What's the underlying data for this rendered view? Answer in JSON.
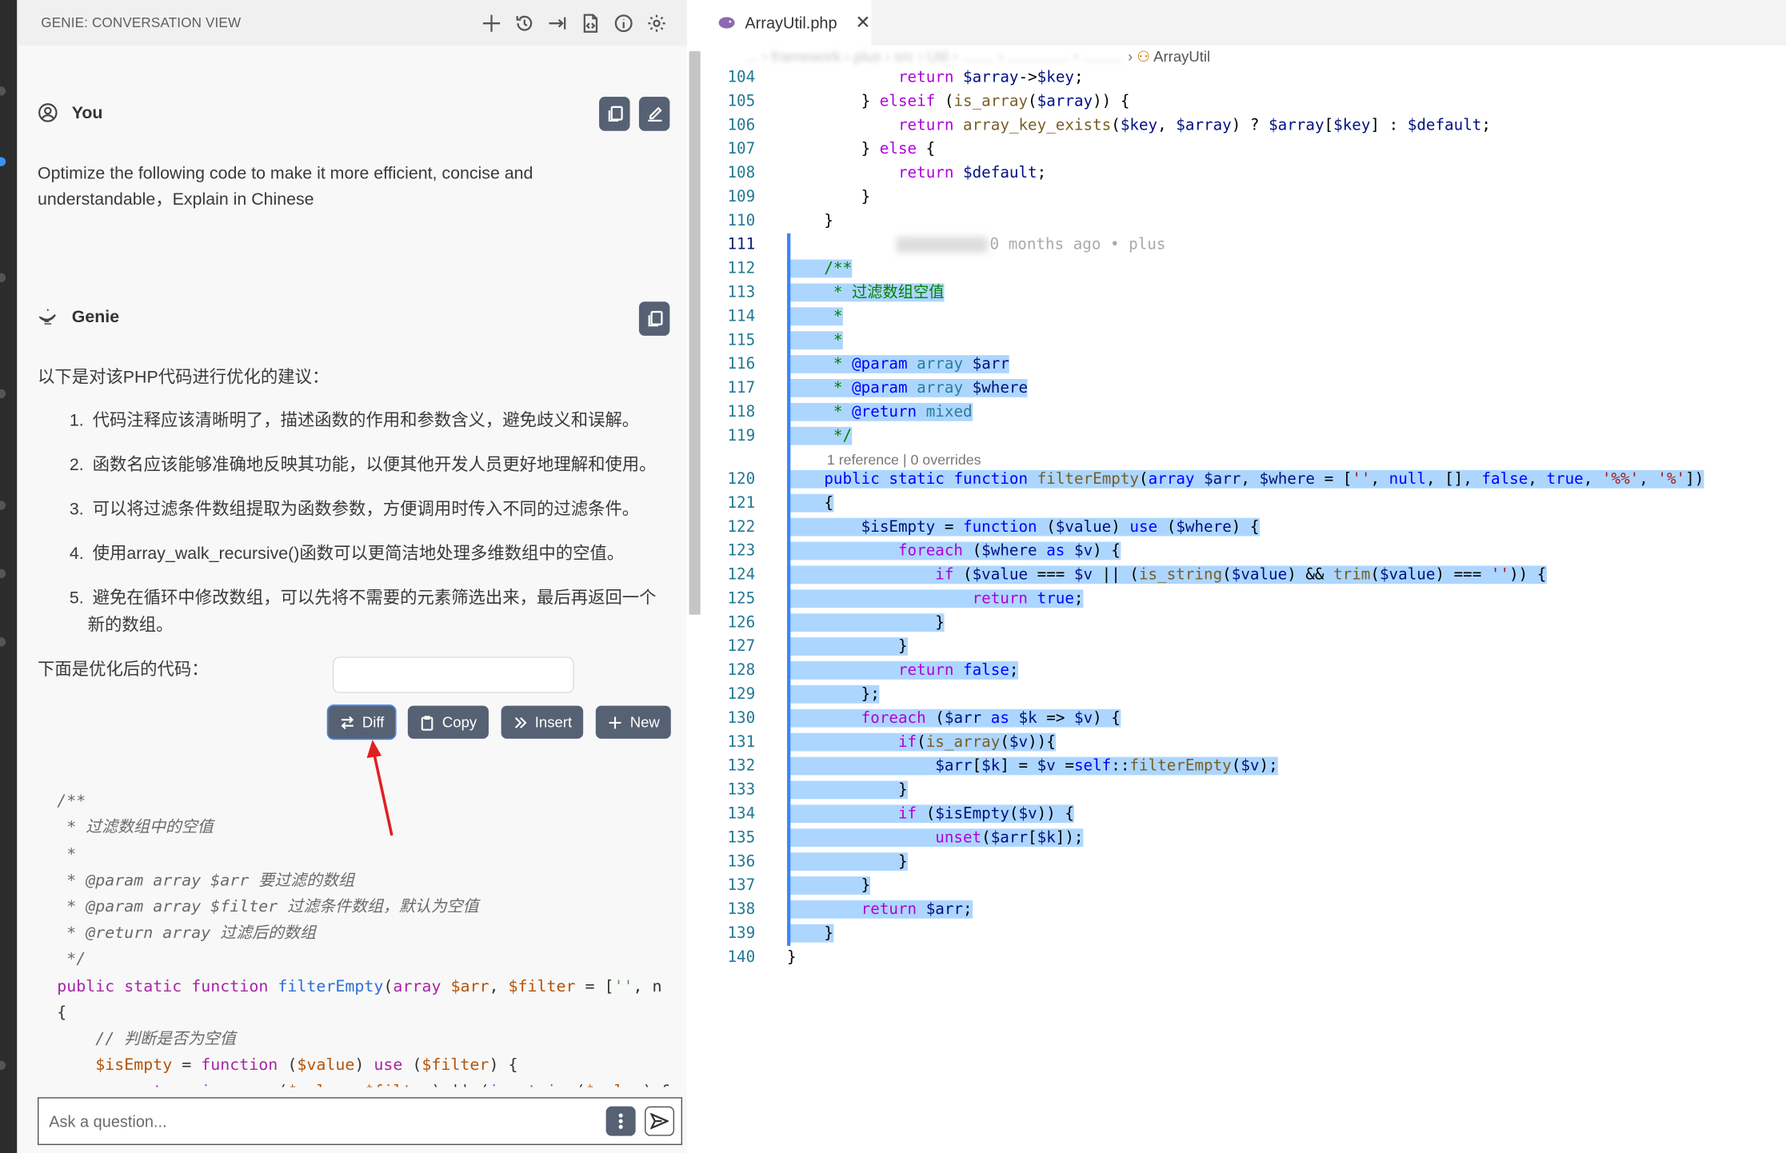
{
  "genie": {
    "title": "GENIE: CONVERSATION VIEW",
    "user": {
      "name": "You",
      "message": "Optimize the following code to make it more efficient, concise and understandable，Explain in Chinese"
    },
    "assistant": {
      "name": "Genie",
      "intro": "以下是对该PHP代码进行优化的建议：",
      "suggestions": [
        "代码注释应该清晰明了，描述函数的作用和参数含义，避免歧义和误解。",
        "函数名应该能够准确地反映其功能，以便其他开发人员更好地理解和使用。",
        "可以将过滤条件数组提取为函数参数，方便调用时传入不同的过滤条件。",
        "使用array_walk_recursive()函数可以更简洁地处理多维数组中的空值。",
        "避免在循环中修改数组，可以先将不需要的元素筛选出来，最后再返回一个新的数组。"
      ],
      "code_intro": "下面是优化后的代码："
    },
    "code_actions": {
      "diff": "Diff",
      "copy": "Copy",
      "insert": "Insert",
      "new": "New"
    },
    "code_lines": [
      "/**",
      " * 过滤数组中的空值",
      " *",
      " * @param array $arr 要过滤的数组",
      " * @param array $filter 过滤条件数组，默认为空值",
      " * @return array 过滤后的数组",
      " */",
      "public static function filterEmpty(array $arr, $filter = ['', n",
      "{",
      "    // 判断是否为空值",
      "    $isEmpty = function ($value) use ($filter) {",
      "        return in_array($value, $filter) || (is_string($value) &"
    ],
    "ask_placeholder": "Ask a question..."
  },
  "editor": {
    "tab": "ArrayUtil.php",
    "breadcrumb_tail": "ArrayUtil",
    "blame": "0 months ago • plus",
    "codelens": "1 reference | 0 overrides",
    "lines": [
      {
        "n": "104",
        "t": "            return $array->$key;"
      },
      {
        "n": "105",
        "t": "        } elseif (is_array($array)) {"
      },
      {
        "n": "106",
        "t": "            return array_key_exists($key, $array) ? $array[$key] : $default;"
      },
      {
        "n": "107",
        "t": "        } else {"
      },
      {
        "n": "108",
        "t": "            return $default;"
      },
      {
        "n": "109",
        "t": "        }"
      },
      {
        "n": "110",
        "t": "    }"
      },
      {
        "n": "111",
        "t": ""
      },
      {
        "n": "112",
        "t": "    /**"
      },
      {
        "n": "113",
        "t": "     * 过滤数组空值"
      },
      {
        "n": "114",
        "t": "     *"
      },
      {
        "n": "115",
        "t": "     *"
      },
      {
        "n": "116",
        "t": "     * @param array $arr"
      },
      {
        "n": "117",
        "t": "     * @param array $where"
      },
      {
        "n": "118",
        "t": "     * @return mixed"
      },
      {
        "n": "119",
        "t": "     */"
      },
      {
        "n": "120",
        "t": "    public static function filterEmpty(array $arr, $where = ['', null, [], false, true, '%%', '%'])"
      },
      {
        "n": "121",
        "t": "    {"
      },
      {
        "n": "122",
        "t": "        $isEmpty = function ($value) use ($where) {"
      },
      {
        "n": "123",
        "t": "            foreach ($where as $v) {"
      },
      {
        "n": "124",
        "t": "                if ($value === $v || (is_string($value) && trim($value) === '')) {"
      },
      {
        "n": "125",
        "t": "                    return true;"
      },
      {
        "n": "126",
        "t": "                }"
      },
      {
        "n": "127",
        "t": "            }"
      },
      {
        "n": "128",
        "t": "            return false;"
      },
      {
        "n": "129",
        "t": "        };"
      },
      {
        "n": "130",
        "t": "        foreach ($arr as $k => $v) {"
      },
      {
        "n": "131",
        "t": "            if(is_array($v)){"
      },
      {
        "n": "132",
        "t": "                $arr[$k] = $v =self::filterEmpty($v);"
      },
      {
        "n": "133",
        "t": "            }"
      },
      {
        "n": "134",
        "t": "            if ($isEmpty($v)) {"
      },
      {
        "n": "135",
        "t": "                unset($arr[$k]);"
      },
      {
        "n": "136",
        "t": "            }"
      },
      {
        "n": "137",
        "t": "        }"
      },
      {
        "n": "138",
        "t": "        return $arr;"
      },
      {
        "n": "139",
        "t": "    }"
      },
      {
        "n": "140",
        "t": "}"
      }
    ]
  }
}
